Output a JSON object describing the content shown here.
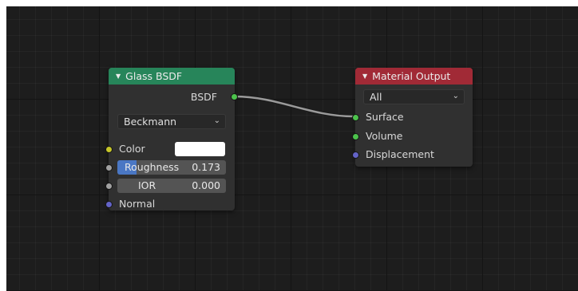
{
  "glass_node": {
    "title": "Glass BSDF",
    "output_label": "BSDF",
    "distribution": "Beckmann",
    "inputs": {
      "color_label": "Color",
      "color_value": "#ffffff",
      "roughness_label": "Roughness",
      "roughness_value": "0.173",
      "roughness_fraction": 0.173,
      "ior_label": "IOR",
      "ior_value": "0.000",
      "normal_label": "Normal"
    },
    "header_color": "#27855a"
  },
  "output_node": {
    "title": "Material Output",
    "target": "All",
    "inputs": {
      "surface_label": "Surface",
      "volume_label": "Volume",
      "displacement_label": "Displacement"
    },
    "header_color": "#a12a36"
  },
  "socket_colors": {
    "shader": "#4cc24c",
    "color": "#c7c729",
    "float": "#a1a1a1",
    "vector": "#6363c7"
  },
  "icons": {
    "collapse": "triangle-down-icon",
    "dropdown": "chevron-down-icon"
  }
}
